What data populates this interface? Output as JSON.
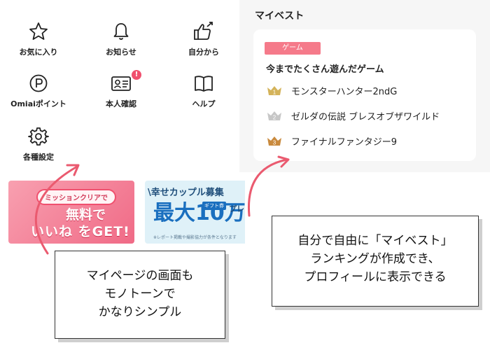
{
  "menu": {
    "items": [
      {
        "label": "お気に入り",
        "icon": "star-icon"
      },
      {
        "label": "お知らせ",
        "icon": "bell-icon"
      },
      {
        "label": "自分から",
        "icon": "thumbs-up-icon"
      },
      {
        "label": "Omiaiポイント",
        "icon": "point-icon"
      },
      {
        "label": "本人確認",
        "icon": "id-card-icon",
        "badge": "!"
      },
      {
        "label": "ヘルプ",
        "icon": "book-icon"
      },
      {
        "label": "各種設定",
        "icon": "gear-icon"
      }
    ]
  },
  "banners": {
    "mission": {
      "pill": "ミッションクリアで",
      "line1": "無料で",
      "line2": "いいね をGET!"
    },
    "couple": {
      "title": "\\幸せカップル募集",
      "amount": "最大10万円",
      "gift": "ギフト券",
      "side": "プレ",
      "note": "※レポート掲載や撮影協力が条件となります"
    }
  },
  "mybest": {
    "title": "マイベスト",
    "tag": "ゲーム",
    "heading": "今までたくさん遊んだゲーム",
    "ranks": [
      {
        "num": "1",
        "label": "モンスターハンター2ndG",
        "color": "#d4b35a"
      },
      {
        "num": "2",
        "label": "ゼルダの伝説 ブレスオブザワイルド",
        "color": "#c7c7c7"
      },
      {
        "num": "3",
        "label": "ファイナルファンタジー9",
        "color": "#c98a3e"
      }
    ]
  },
  "callouts": {
    "left": [
      "マイページの画面も",
      "モノトーンで",
      "かなりシンプル"
    ],
    "right": [
      "自分で自由に「マイベスト」",
      "ランキングが作成でき、",
      "プロフィールに表示できる"
    ]
  },
  "colors": {
    "accent": "#f0506e",
    "arrow": "#ea5a6f"
  }
}
